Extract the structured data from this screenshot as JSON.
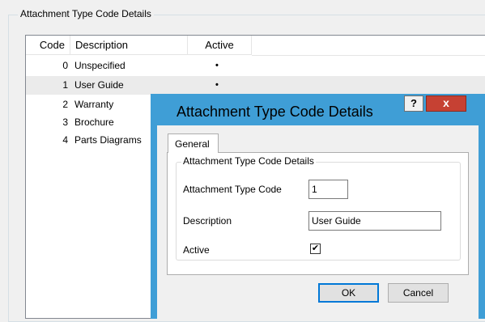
{
  "background": {
    "group_title": "Attachment Type Code Details",
    "columns": [
      "Code",
      "Description",
      "Active"
    ],
    "rows": [
      {
        "code": "0",
        "description": "Unspecified",
        "active": "•"
      },
      {
        "code": "1",
        "description": "User Guide",
        "active": "•"
      },
      {
        "code": "2",
        "description": "Warranty",
        "active": ""
      },
      {
        "code": "3",
        "description": "Brochure",
        "active": ""
      },
      {
        "code": "4",
        "description": "Parts Diagrams",
        "active": ""
      }
    ]
  },
  "dialog": {
    "title": "Attachment Type Code Details",
    "help_label": "?",
    "close_label": "x",
    "tab_label": "General",
    "group_title": "Attachment Type Code Details",
    "fields": {
      "code_label": "Attachment Type Code",
      "code_value": "1",
      "description_label": "Description",
      "description_value": "User Guide",
      "active_label": "Active",
      "active_checked": "✔"
    },
    "ok_label": "OK",
    "cancel_label": "Cancel"
  },
  "colors": {
    "dialog_frame": "#3f9ed6",
    "close_button": "#c64133",
    "selected_row": "#ebebeb"
  }
}
